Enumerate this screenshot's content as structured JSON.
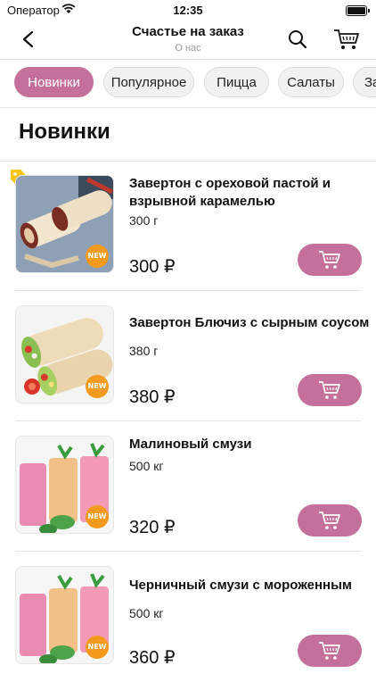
{
  "status_bar": {
    "carrier": "Оператор",
    "time": "12:35"
  },
  "nav": {
    "title": "Счастье на заказ",
    "subtitle": "О нас",
    "icons": [
      "back-chevron-icon",
      "search-icon",
      "cart-icon"
    ]
  },
  "categories": [
    {
      "label": "Новинки",
      "active": true
    },
    {
      "label": "Популярное",
      "active": false
    },
    {
      "label": "Пицца",
      "active": false
    },
    {
      "label": "Салаты",
      "active": false
    },
    {
      "label": "Зак",
      "active": false
    }
  ],
  "section_title": "Новинки",
  "accent_color": "#c4709a",
  "products": [
    {
      "name": "Завертон с ореховой пастой и взрывной карамелью",
      "weight": "300 г",
      "price": "300 ₽",
      "badge": "NEW",
      "promo": true
    },
    {
      "name": "Завертон Блючиз с сырным соусом",
      "weight": "380 г",
      "price": "380 ₽",
      "badge": "NEW",
      "promo": false
    },
    {
      "name": "Малиновый смузи",
      "weight": "500 кг",
      "price": "320 ₽",
      "badge": "NEW",
      "promo": false
    },
    {
      "name": "Черничный смузи с мороженным",
      "weight": "500 кг",
      "price": "360 ₽",
      "badge": "NEW",
      "promo": false
    }
  ]
}
